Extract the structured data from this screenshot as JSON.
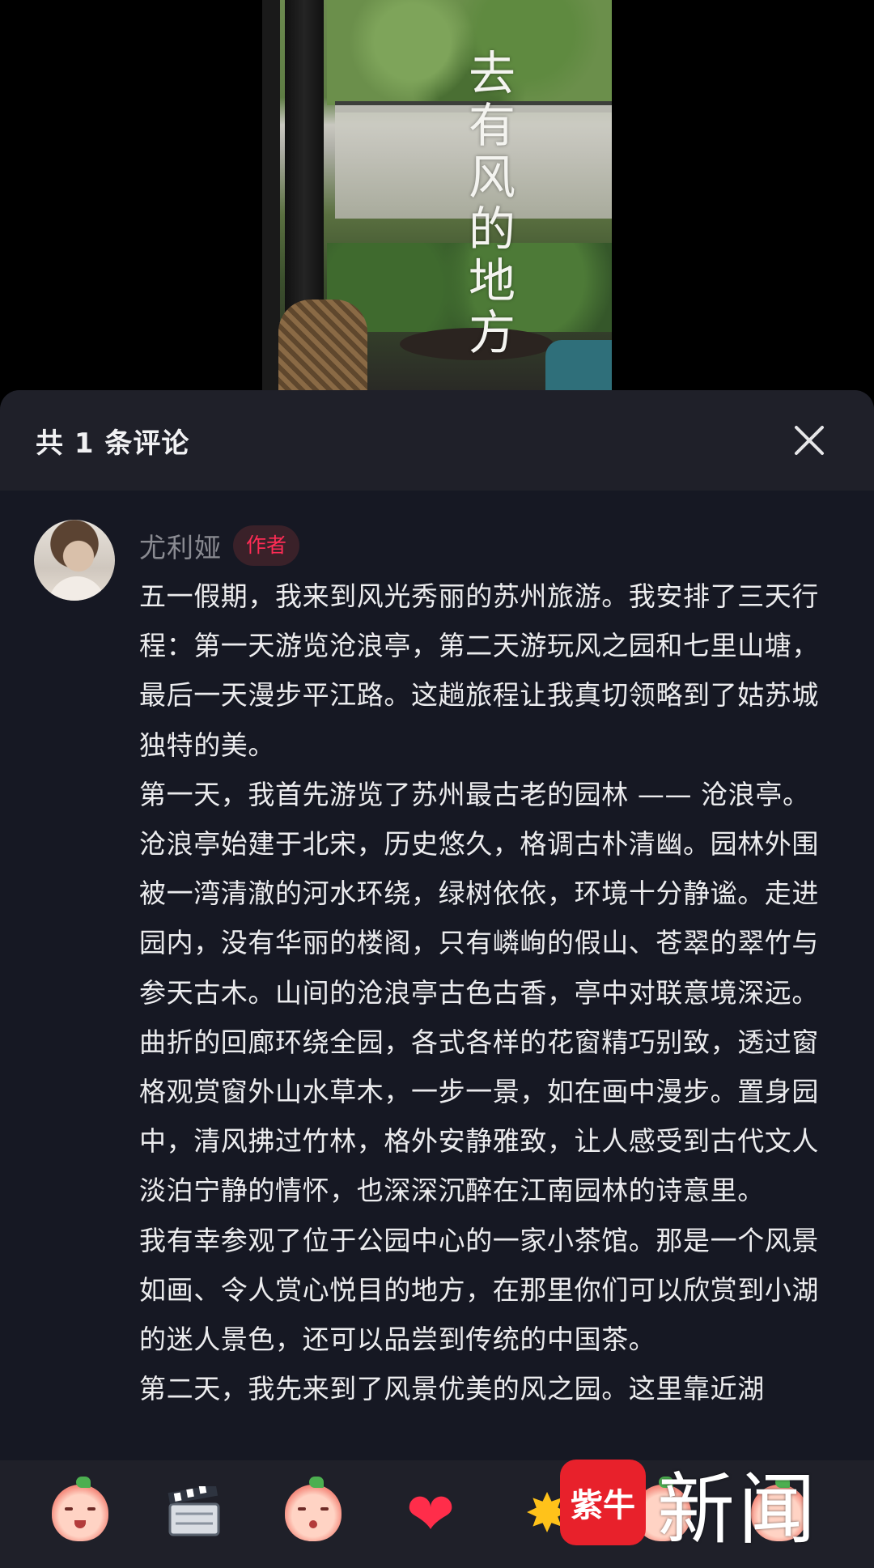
{
  "video": {
    "caption": "去有风的地方"
  },
  "comments_panel": {
    "title": "共 1 条评论",
    "close_icon": "close-icon"
  },
  "comment": {
    "author": "尤利娅",
    "author_badge": "作者",
    "text": "五一假期，我来到风光秀丽的苏州旅游。我安排了三天行程：第一天游览沧浪亭，第二天游玩风之园和七里山塘，最后一天漫步平江路。这趟旅程让我真切领略到了姑苏城独特的美。\n第一天，我首先游览了苏州最古老的园林 —— 沧浪亭。沧浪亭始建于北宋，历史悠久，格调古朴清幽。园林外围被一湾清澈的河水环绕，绿树依依，环境十分静谧。走进园内，没有华丽的楼阁，只有嶙峋的假山、苍翠的翠竹与参天古木。山间的沧浪亭古色古香，亭中对联意境深远。曲折的回廊环绕全园，各式各样的花窗精巧别致，透过窗格观赏窗外山水草木，一步一景，如在画中漫步。置身园中，清风拂过竹林，格外安静雅致，让人感受到古代文人淡泊宁静的情怀，也深深沉醉在江南园林的诗意里。\n我有幸参观了位于公园中心的一家小茶馆。那是一个风景如画、令人赏心悦目的地方，在那里你们可以欣赏到小湖的迷人景色，还可以品尝到传统的中国茶。\n第二天，我先来到了风景优美的风之园。这里靠近湖"
  },
  "emoji_bar": {
    "items": [
      "laughing-peach-emoji",
      "clapperboard-emoji",
      "kissing-peach-emoji",
      "heart-emoji",
      "star-emoji",
      "peach-emoji",
      "peach-emoji"
    ]
  },
  "watermark": {
    "logo_text": "紫牛",
    "text": "新闻"
  },
  "colors": {
    "sheet_bg": "#161823",
    "header_bg": "#1f2029",
    "badge_text": "#fe2c55",
    "badge_bg": "#3a2129",
    "author_name": "#8a8b92",
    "body_text": "#ececee"
  }
}
